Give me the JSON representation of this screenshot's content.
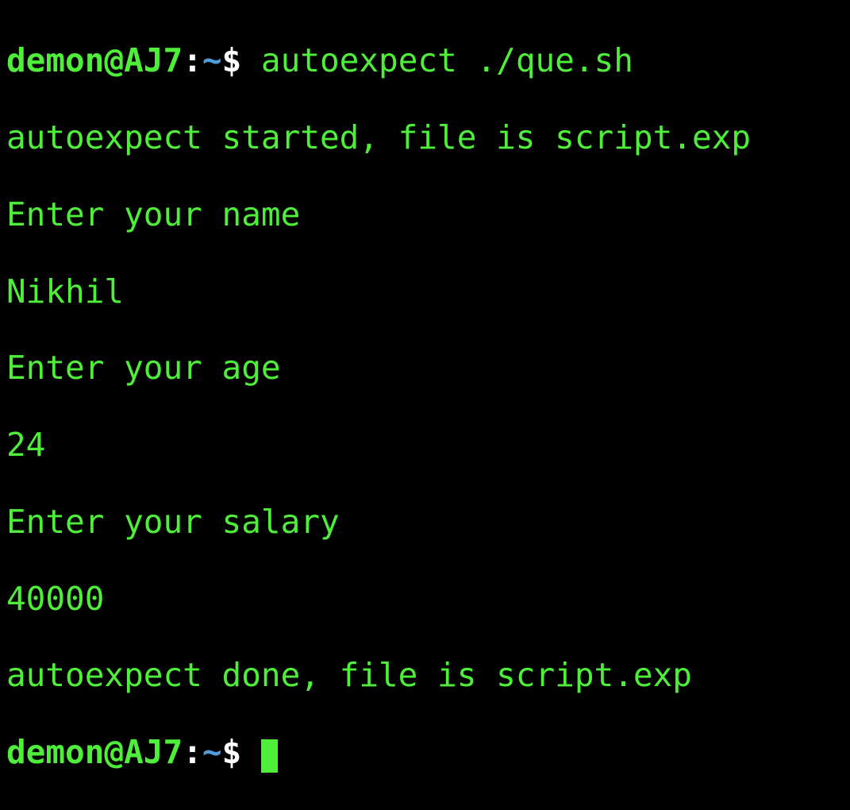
{
  "prompt1": {
    "user_host": "demon@AJ7",
    "colon": ":",
    "path": "~",
    "dollar": "$ ",
    "command": "autoexpect ./que.sh"
  },
  "output": {
    "line1": "autoexpect started, file is script.exp",
    "line2": "Enter your name",
    "line3": "Nikhil",
    "line4": "Enter your age",
    "line5": "24",
    "line6": "Enter your salary",
    "line7": "40000",
    "line8": "autoexpect done, file is script.exp"
  },
  "prompt2": {
    "user_host": "demon@AJ7",
    "colon": ":",
    "path": "~",
    "dollar": "$ "
  }
}
